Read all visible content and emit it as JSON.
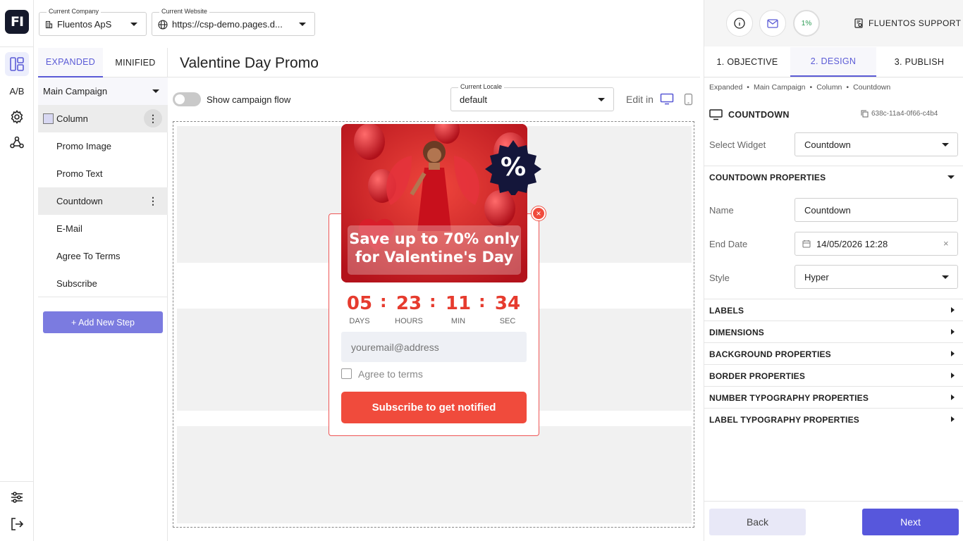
{
  "logo": "FI",
  "rail": {
    "ab_label": "A/B"
  },
  "topbar": {
    "company": {
      "label": "Current Company",
      "value": "Fluentos ApS"
    },
    "website": {
      "label": "Current Website",
      "value": "https://csp-demo.pages.d..."
    }
  },
  "left_panel": {
    "tabs": [
      "EXPANDED",
      "MINIFIED"
    ],
    "campaign": "Main Campaign",
    "items": [
      "Column",
      "Promo Image",
      "Promo Text",
      "Countdown",
      "E-Mail",
      "Agree To Terms",
      "Subscribe"
    ],
    "add_step": "+ Add New Step"
  },
  "center": {
    "title": "Valentine Day Promo",
    "flow_label": "Show campaign flow",
    "locale": {
      "label": "Current Locale",
      "value": "default"
    },
    "edit_in": "Edit in"
  },
  "popup": {
    "badge": "%",
    "headline_1": "Save up to 70% only",
    "headline_2": "for Valentine's Day",
    "close": "×",
    "countdown": [
      {
        "num": "05",
        "label": "DAYS"
      },
      {
        "num": "23",
        "label": "HOURS"
      },
      {
        "num": "11",
        "label": "MIN"
      },
      {
        "num": "34",
        "label": "SEC"
      }
    ],
    "separator": ":",
    "email_placeholder": "youremail@address",
    "agree": "Agree to terms",
    "submit": "Subscribe to get notified"
  },
  "right_panel": {
    "progress": "1%",
    "support": "FLUENTOS SUPPORT",
    "tabs": [
      "1. OBJECTIVE",
      "2. DESIGN",
      "3. PUBLISH"
    ],
    "breadcrumb": [
      "Expanded",
      "Main Campaign",
      "Column",
      "Countdown"
    ],
    "widget_header": "COUNTDOWN",
    "widget_id": "638c-11a4-0f66-c4b4",
    "select_widget": {
      "label": "Select Widget",
      "value": "Countdown"
    },
    "section_open": "COUNTDOWN PROPERTIES",
    "fields": {
      "name": {
        "label": "Name",
        "value": "Countdown"
      },
      "end_date": {
        "label": "End Date",
        "value": "14/05/2026 12:28"
      },
      "style": {
        "label": "Style",
        "value": "Hyper"
      }
    },
    "sections": [
      "LABELS",
      "DIMENSIONS",
      "BACKGROUND PROPERTIES",
      "BORDER PROPERTIES",
      "NUMBER TYPOGRAPHY PROPERTIES",
      "LABEL TYPOGRAPHY PROPERTIES"
    ],
    "back": "Back",
    "next": "Next"
  },
  "colors": {
    "accent": "#5b5bd6",
    "promo_red": "#f04b3c",
    "countdown_red": "#e63b2e"
  }
}
